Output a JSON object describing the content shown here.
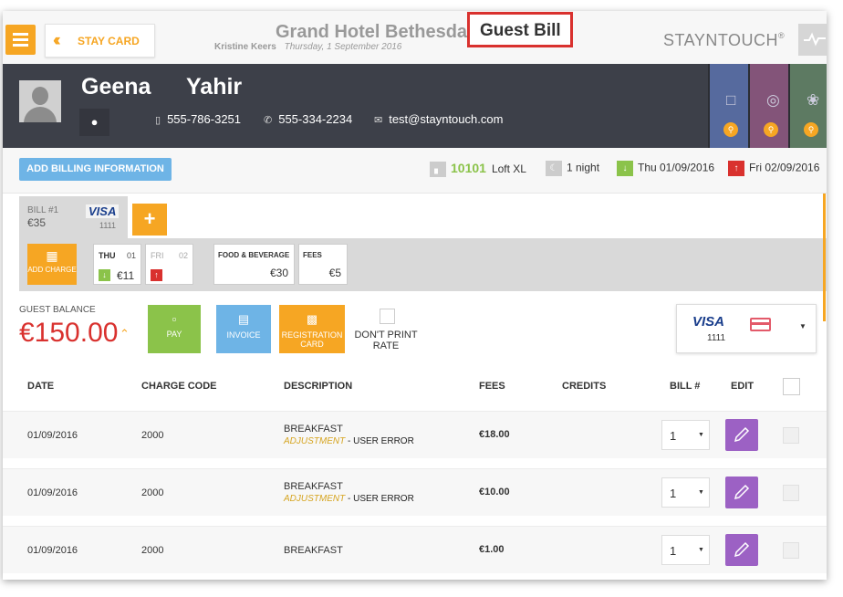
{
  "topbar": {
    "stay_card_label": "STAY CARD",
    "hotel_name": "Grand Hotel Bethesda",
    "page_title": "Guest Bill",
    "user_name": "Kristine Keers",
    "business_date": "Thursday, 1 September 2016",
    "logo_text": "STAYNTOUCH",
    "logo_mark": "®"
  },
  "guest": {
    "first_name": "Geena",
    "last_name": "Yahir",
    "phone": "555-786-3251",
    "alt_phone": "555-334-2234",
    "email": "test@stayntouch.com"
  },
  "stay": {
    "add_billing_label": "ADD BILLING INFORMATION",
    "room_number": "10101",
    "room_type": "Loft XL",
    "nights": "1 night",
    "arrival": "Thu 01/09/2016",
    "departure": "Fri 02/09/2016"
  },
  "bill": {
    "tab_label": "BILL #1",
    "tab_amount": "€35",
    "tab_card": "VISA",
    "tab_card_number": "1111",
    "add_bill_label": "+",
    "add_charge_label": "ADD CHARGE",
    "days": [
      {
        "day": "THU",
        "num": "01",
        "amount": "€11"
      },
      {
        "day": "FRI",
        "num": "02"
      }
    ],
    "categories": [
      {
        "title": "FOOD & BEVERAGE",
        "value": "€30"
      },
      {
        "title": "FEES",
        "value": "€5"
      }
    ]
  },
  "balance": {
    "label": "GUEST BALANCE",
    "amount": "€150.00",
    "pay_label": "PAY",
    "invoice_label": "INVOICE",
    "registration_label": "REGISTRATION CARD",
    "dont_print_label": "DON'T PRINT RATE",
    "card_brand": "VISA",
    "card_number": "1111"
  },
  "table": {
    "headers": {
      "date": "DATE",
      "charge_code": "CHARGE CODE",
      "description": "DESCRIPTION",
      "fees": "FEES",
      "credits": "CREDITS",
      "bill_no": "BILL #",
      "edit": "EDIT"
    },
    "rows": [
      {
        "date": "01/09/2016",
        "code": "2000",
        "desc": "BREAKFAST",
        "adj": "ADJUSTMENT",
        "sep": " - ",
        "reason": "USER ERROR",
        "fee": "€18.00",
        "bill": "1"
      },
      {
        "date": "01/09/2016",
        "code": "2000",
        "desc": "BREAKFAST",
        "adj": "ADJUSTMENT",
        "sep": " - ",
        "reason": "USER ERROR",
        "fee": "€10.00",
        "bill": "1"
      },
      {
        "date": "01/09/2016",
        "code": "2000",
        "desc": "BREAKFAST",
        "fee": "€1.00",
        "bill": "1"
      }
    ]
  },
  "colors": {
    "accent_orange": "#f6a623",
    "balance_red": "#d9312e",
    "pay_green": "#8bc34a",
    "invoice_blue": "#6eb4e6",
    "edit_purple": "#9c61c4",
    "header_dark": "#3d4049"
  },
  "icons": [
    "menu-icon",
    "double-chevron-left-icon",
    "pulse-icon",
    "avatar-icon",
    "location-pin-icon",
    "mobile-phone-icon",
    "phone-icon",
    "email-icon",
    "hotel-icon",
    "globe-icon",
    "search-icon",
    "bed-icon",
    "moon-icon",
    "arrival-arrow-icon",
    "departure-arrow-icon",
    "calculator-icon",
    "wallet-icon",
    "document-icon",
    "printer-icon",
    "credit-card-icon",
    "caret-up-icon",
    "dropdown-caret-icon",
    "pencil-icon"
  ]
}
